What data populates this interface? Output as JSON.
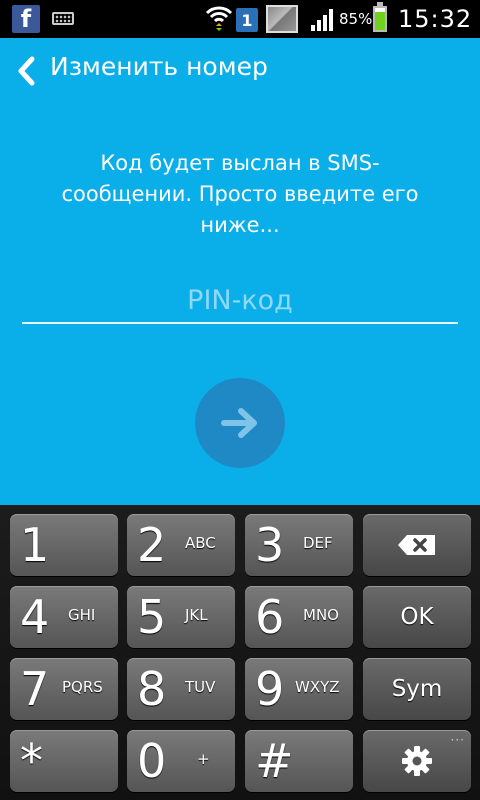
{
  "status_bar": {
    "icons": [
      "facebook-icon",
      "keyboard-icon",
      "wifi-icon",
      "sim-icon",
      "gallery-icon",
      "signal-icon",
      "battery-icon"
    ],
    "sim_number": "1",
    "battery_percent": "85%",
    "time": "15:32"
  },
  "header": {
    "back_icon": "chevron-left-icon",
    "title": "Изменить номер"
  },
  "main": {
    "message": "Код будет выслан в SMS-сообщении. Просто введите его ниже...",
    "pin_placeholder": "PIN-код",
    "pin_value": "",
    "submit_icon": "arrow-right-icon"
  },
  "keypad": {
    "keys": [
      {
        "digit": "1",
        "letters": ""
      },
      {
        "digit": "2",
        "letters": "ABC"
      },
      {
        "digit": "3",
        "letters": "DEF"
      },
      {
        "digit": "4",
        "letters": "GHI"
      },
      {
        "digit": "5",
        "letters": "JKL"
      },
      {
        "digit": "6",
        "letters": "MNO"
      },
      {
        "digit": "7",
        "letters": "PQRS"
      },
      {
        "digit": "8",
        "letters": "TUV"
      },
      {
        "digit": "9",
        "letters": "WXYZ"
      },
      {
        "digit": "*",
        "letters": ""
      },
      {
        "digit": "0",
        "letters": "+"
      },
      {
        "digit": "#",
        "letters": ""
      }
    ],
    "backspace_icon": "backspace-icon",
    "ok_label": "OK",
    "sym_label": "Sym",
    "settings_icon": "gear-icon",
    "more_indicator": "···"
  },
  "colors": {
    "background": "#0aaee9",
    "submit_button": "#1e89c4",
    "status_bar": "#000000",
    "keypad_bg": "#151515"
  }
}
